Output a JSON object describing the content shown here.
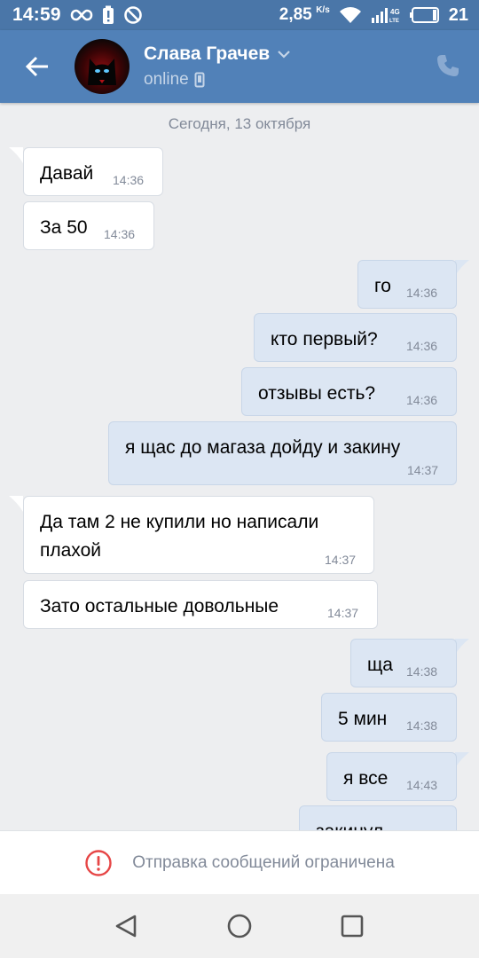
{
  "status_bar": {
    "time": "14:59",
    "speed": "2,85",
    "speed_unit": "K/s",
    "network_type": "4G",
    "battery": "21",
    "icons": [
      "infinity-icon",
      "battery-alert-icon",
      "dnd-icon",
      "wifi-icon",
      "signal-icon",
      "battery-icon"
    ]
  },
  "header": {
    "contact_name": "Слава Грачев",
    "status": "online",
    "icons": [
      "back-arrow-icon",
      "chevron-down-icon",
      "phone-device-icon",
      "phone-call-icon"
    ]
  },
  "chat": {
    "date_divider": "Сегодня, 13 октября",
    "messages": [
      {
        "direction": "in",
        "text": "Давай",
        "time": "14:36"
      },
      {
        "direction": "in",
        "text": "За 50",
        "time": "14:36"
      },
      {
        "direction": "out",
        "text": "го",
        "time": "14:36"
      },
      {
        "direction": "out",
        "text": "кто первый?",
        "time": "14:36"
      },
      {
        "direction": "out",
        "text": "отзывы есть?",
        "time": "14:36"
      },
      {
        "direction": "out",
        "text": "я щас до магаза дойду и закину",
        "time": "14:37"
      },
      {
        "direction": "in",
        "text": "Да там 2 не купили но написали плахой",
        "line1": "Да там 2 не купили но написали",
        "line2": "плахой",
        "time": "14:37"
      },
      {
        "direction": "in",
        "text": "Зато остальные довольные",
        "time": "14:37"
      },
      {
        "direction": "out",
        "text": "ща",
        "time": "14:38"
      },
      {
        "direction": "out",
        "text": "5 мин",
        "time": "14:38"
      },
      {
        "direction": "out",
        "text": "я все",
        "time": "14:43"
      },
      {
        "direction": "out",
        "text": "закинул",
        "time": ""
      }
    ]
  },
  "restriction": {
    "text": "Отправка сообщений ограничена",
    "icon": "alert-circle-icon",
    "color": "#e64646"
  },
  "navbar": {
    "icons": [
      "nav-back-icon",
      "nav-home-icon",
      "nav-recents-icon"
    ]
  },
  "colors": {
    "header": "#5181b8",
    "status_bar": "#4a76a8",
    "background": "#edeef0",
    "incoming_bubble": "#ffffff",
    "outgoing_bubble": "#dce6f3"
  }
}
